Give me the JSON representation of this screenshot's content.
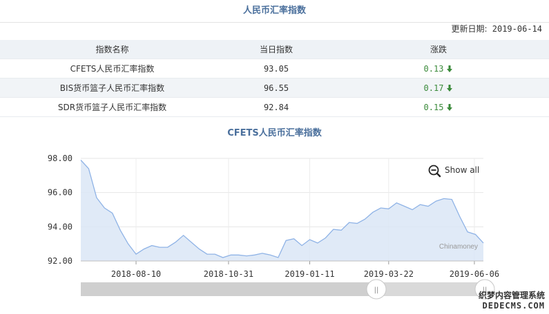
{
  "page_title": "人民币汇率指数",
  "update": {
    "label": "更新日期:",
    "date": "2019-06-14"
  },
  "table": {
    "headers": [
      "指数名称",
      "当日指数",
      "涨跌"
    ],
    "rows": [
      {
        "name": "CFETS人民币汇率指数",
        "value": "93.05",
        "change": "0.13"
      },
      {
        "name": "BIS货币篮子人民币汇率指数",
        "value": "96.55",
        "change": "0.17"
      },
      {
        "name": "SDR货币篮子人民币汇率指数",
        "value": "92.84",
        "change": "0.15"
      }
    ]
  },
  "colors": {
    "accent": "#4a6f9c",
    "down": "#3a8a3a",
    "series_line": "#8fb3e6",
    "series_fill": "#dbe6f6"
  },
  "chart_data": {
    "type": "area",
    "title": "CFETS人民币汇率指数",
    "ylim": [
      92,
      98
    ],
    "y_ticks": [
      "92.00",
      "94.00",
      "96.00",
      "98.00"
    ],
    "x_ticks": [
      "2018-08-10",
      "2018-10-31",
      "2019-01-11",
      "2019-03-22",
      "2019-06-06"
    ],
    "x_range": [
      "2018-06-22",
      "2019-06-14"
    ],
    "grid": true,
    "show_all_label": "Show all",
    "credit": "Chinamoney",
    "series": [
      {
        "x": [
          "2018-06-22",
          "2018-06-29",
          "2018-07-06",
          "2018-07-13",
          "2018-07-20",
          "2018-07-27",
          "2018-08-03",
          "2018-08-10",
          "2018-08-17",
          "2018-08-24",
          "2018-08-31",
          "2018-09-07",
          "2018-09-14",
          "2018-09-21",
          "2018-09-28",
          "2018-10-05",
          "2018-10-12",
          "2018-10-19",
          "2018-10-26",
          "2018-11-02",
          "2018-11-09",
          "2018-11-16",
          "2018-11-23",
          "2018-11-30",
          "2018-12-07",
          "2018-12-14",
          "2018-12-21",
          "2018-12-28",
          "2019-01-04",
          "2019-01-11",
          "2019-01-18",
          "2019-01-25",
          "2019-02-01",
          "2019-02-08",
          "2019-02-15",
          "2019-02-22",
          "2019-03-01",
          "2019-03-08",
          "2019-03-15",
          "2019-03-22",
          "2019-03-29",
          "2019-04-05",
          "2019-04-12",
          "2019-04-19",
          "2019-04-26",
          "2019-05-03",
          "2019-05-10",
          "2019-05-17",
          "2019-05-24",
          "2019-05-31",
          "2019-06-07",
          "2019-06-14"
        ],
        "values": [
          97.9,
          97.4,
          95.7,
          95.1,
          94.8,
          93.8,
          93.0,
          92.4,
          92.7,
          92.9,
          92.8,
          92.8,
          93.1,
          93.5,
          93.1,
          92.7,
          92.4,
          92.4,
          92.2,
          92.35,
          92.35,
          92.3,
          92.35,
          92.45,
          92.35,
          92.2,
          93.2,
          93.3,
          92.9,
          93.25,
          93.05,
          93.35,
          93.85,
          93.8,
          94.25,
          94.2,
          94.45,
          94.85,
          95.1,
          95.05,
          95.4,
          95.2,
          95.0,
          95.3,
          95.2,
          95.5,
          95.65,
          95.6,
          94.6,
          93.7,
          93.55,
          93.05
        ]
      }
    ]
  },
  "scrollbar": {
    "handle_label": "||"
  },
  "watermark": {
    "line1": "织梦内容管理系统",
    "line2": "DEDECMS.COM"
  }
}
